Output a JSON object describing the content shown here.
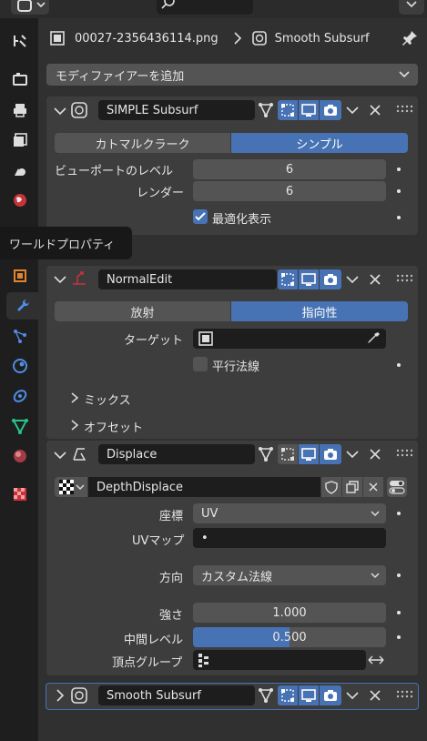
{
  "breadcrumb": {
    "object": "00027-2356436114.png",
    "modifier": "Smooth Subsurf"
  },
  "add_modifier": "モディファイアーを追加",
  "tooltip": "ワールドプロパティ",
  "mod1": {
    "name": "SIMPLE Subsurf",
    "mode_a": "カトマルクラーク",
    "mode_b": "シンプル",
    "viewport_label": "ビューポートのレベル",
    "viewport_value": "6",
    "render_label": "レンダー",
    "render_value": "6",
    "optimal_label": "最適化表示"
  },
  "mod2": {
    "name": "NormalEdit",
    "mode_a": "放射",
    "mode_b": "指向性",
    "target_label": "ターゲット",
    "parallel_label": "平行法線",
    "mix_label": "ミックス",
    "offset_label": "オフセット"
  },
  "mod3": {
    "name": "Displace",
    "texture": "DepthDisplace",
    "coords_label": "座標",
    "coords_value": "UV",
    "uvmap_label": "UVマップ",
    "uvmap_value": "•",
    "direction_label": "方向",
    "direction_value": "カスタム法線",
    "strength_label": "強さ",
    "strength_value": "1.000",
    "midlevel_label": "中間レベル",
    "midlevel_value": "0.500",
    "midlevel_fraction": 0.5,
    "vgroup_label": "頂点グループ"
  },
  "mod4": {
    "name": "Smooth Subsurf"
  },
  "colors": {
    "accent": "#4772b3",
    "panel": "#3d3d3d",
    "bg": "#303030",
    "field": "#545454"
  }
}
